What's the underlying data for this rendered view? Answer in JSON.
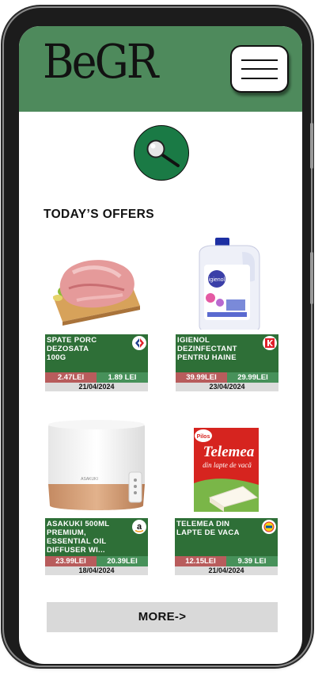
{
  "header": {
    "logo_text": "BeGR"
  },
  "colors": {
    "brand_green": "#4e8a5c",
    "card_green": "#2e6f37",
    "old_price": "#b85c5c",
    "new_price": "#47915a"
  },
  "search": {
    "icon": "search-icon"
  },
  "section": {
    "title": "TODAY’S OFFERS"
  },
  "offers": [
    {
      "name": "SPATE PORC\nDEZOSATA\n100G",
      "store_icon": "carrefour-logo-icon",
      "old_price": "2.47LEI",
      "new_price": "1.89 LEI",
      "date": "21/04/2024"
    },
    {
      "name": "IGIENOL\nDEZINFECTANT\nPENTRU HAINE",
      "store_icon": "kaufland-logo-icon",
      "old_price": "39.99LEI",
      "new_price": "29.99LEI",
      "date": "23/04/2024"
    },
    {
      "name": "ASAKUKI 500ML\nPREMIUM,\nESSENTIAL OIL\nDIFFUSER WI...",
      "store_icon": "amazon-logo-icon",
      "old_price": "23.99LEI",
      "new_price": "20.39LEI",
      "date": "18/04/2024"
    },
    {
      "name": "TELEMEA DIN\nLAPTE DE VACA",
      "store_icon": "lidl-logo-icon",
      "old_price": "12.15LEI",
      "new_price": "9.39 LEI",
      "date": "21/04/2024"
    }
  ],
  "product_labels": {
    "igienol": "igienol",
    "telemea_brand": "Pilos",
    "telemea_title": "Telemea",
    "telemea_sub": "din lapte de vacă",
    "diffuser_brand": "ASAKUKI"
  },
  "more": {
    "label": "MORE->"
  }
}
